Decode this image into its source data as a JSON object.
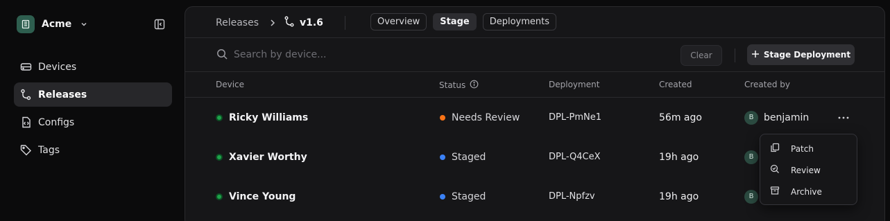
{
  "brand": {
    "name": "Acme"
  },
  "sidebar": {
    "items": [
      {
        "label": "Devices",
        "icon": "devices-icon",
        "active": false
      },
      {
        "label": "Releases",
        "icon": "releases-icon",
        "active": true
      },
      {
        "label": "Configs",
        "icon": "configs-icon",
        "active": false
      },
      {
        "label": "Tags",
        "icon": "tag-icon",
        "active": false
      }
    ]
  },
  "header": {
    "breadcrumb_root": "Releases",
    "breadcrumb_current": "v1.6",
    "tabs": [
      {
        "label": "Overview",
        "active": false
      },
      {
        "label": "Stage",
        "active": true
      },
      {
        "label": "Deployments",
        "active": false
      }
    ]
  },
  "search": {
    "placeholder": "Search by device...",
    "value": ""
  },
  "actions": {
    "clear_label": "Clear",
    "stage_label": "Stage Deployment"
  },
  "table": {
    "columns": [
      "Device",
      "Status",
      "Deployment",
      "Created",
      "Created by"
    ],
    "rows": [
      {
        "device": "Ricky Williams",
        "status": "Needs Review",
        "status_color": "#f97316",
        "deployment": "DPL-PmNe1",
        "created": "56m ago",
        "avatar": "B",
        "created_by": "benjamin"
      },
      {
        "device": "Xavier Worthy",
        "status": "Staged",
        "status_color": "#3b82f6",
        "deployment": "DPL-Q4CeX",
        "created": "19h ago",
        "avatar": "B",
        "created_by": ""
      },
      {
        "device": "Vince Young",
        "status": "Staged",
        "status_color": "#3b82f6",
        "deployment": "DPL-Npfzv",
        "created": "19h ago",
        "avatar": "B",
        "created_by": ""
      }
    ]
  },
  "menu": {
    "items": [
      {
        "label": "Patch",
        "icon": "patch-icon"
      },
      {
        "label": "Review",
        "icon": "review-icon"
      },
      {
        "label": "Archive",
        "icon": "archive-icon"
      }
    ]
  },
  "colors": {
    "online": "#1fa34a",
    "needs_review": "#f97316",
    "staged": "#3b82f6",
    "brand": "#2e5e4f"
  }
}
